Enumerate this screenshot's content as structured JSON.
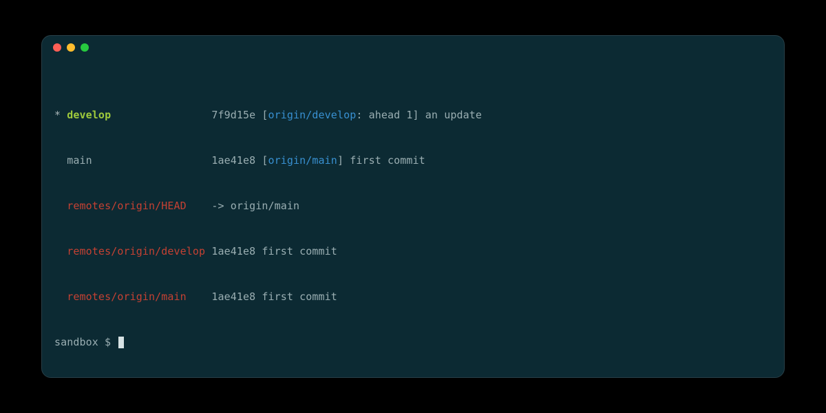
{
  "branches": [
    {
      "marker": "*",
      "name": "develop",
      "name_color": "green",
      "pad": "               ",
      "hash": "7f9d15e",
      "bracket_open": " [",
      "tracking": "origin/develop",
      "tracking_suffix": ": ahead 1",
      "bracket_close": "] ",
      "message": "an update"
    },
    {
      "marker": " ",
      "name": "main",
      "name_color": "dim",
      "pad": "                  ",
      "hash": "1ae41e8",
      "bracket_open": " [",
      "tracking": "origin/main",
      "tracking_suffix": "",
      "bracket_close": "] ",
      "message": "first commit"
    },
    {
      "marker": " ",
      "name": "remotes/origin/HEAD",
      "name_color": "red",
      "pad": "   ",
      "hash": "",
      "bracket_open": "",
      "tracking": "",
      "tracking_suffix": "",
      "bracket_close": "",
      "message": "-> origin/main"
    },
    {
      "marker": " ",
      "name": "remotes/origin/develop",
      "name_color": "red",
      "pad": "",
      "hash": "1ae41e8",
      "bracket_open": "",
      "tracking": "",
      "tracking_suffix": "",
      "bracket_close": "",
      "message": " first commit"
    },
    {
      "marker": " ",
      "name": "remotes/origin/main",
      "name_color": "red",
      "pad": "   ",
      "hash": "1ae41e8",
      "bracket_open": "",
      "tracking": "",
      "tracking_suffix": "",
      "bracket_close": "",
      "message": " first commit"
    }
  ],
  "prompt": {
    "text": "sandbox $ "
  },
  "colors": {
    "bg": "#0c2a33",
    "green": "#9fca3c",
    "red": "#c54133",
    "blue": "#3890d1",
    "dim": "#9aaeb2"
  }
}
